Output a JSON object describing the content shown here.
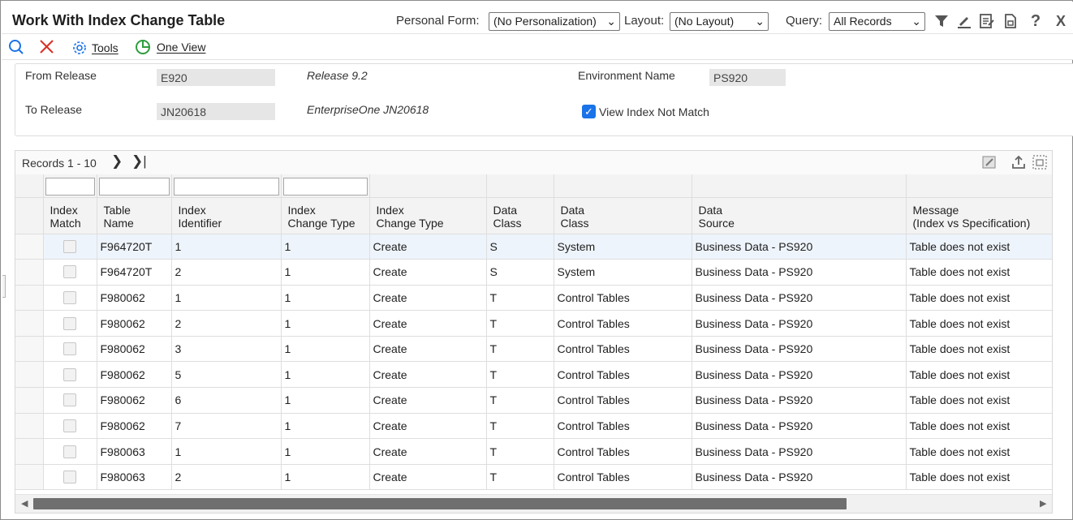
{
  "window": {
    "title": "Work With Index Change Table",
    "personal_form_label": "Personal Form:",
    "personal_form_value": "(No Personalization)",
    "layout_label": "Layout:",
    "layout_value": "(No Layout)",
    "query_label": "Query:",
    "query_value": "All Records",
    "close_glyph": "X",
    "help_glyph": "?"
  },
  "toolbar": {
    "tools_label": "Tools",
    "one_view_label": "One View"
  },
  "header": {
    "from_release_label": "From Release",
    "from_release_value": "E920",
    "from_release_desc": "Release 9.2",
    "to_release_label": "To Release",
    "to_release_value": "JN20618",
    "to_release_desc": "EnterpriseOne JN20618",
    "env_label": "Environment Name",
    "env_value": "PS920",
    "view_index_label": "View Index Not Match",
    "view_index_checked": true
  },
  "grid": {
    "records_label": "Records 1 - 10",
    "columns": [
      {
        "line1": "Index",
        "line2": "Match"
      },
      {
        "line1": "Table",
        "line2": "Name"
      },
      {
        "line1": "Index",
        "line2": "Identifier"
      },
      {
        "line1": "Index",
        "line2": "Change Type"
      },
      {
        "line1": "Index",
        "line2": "Change Type"
      },
      {
        "line1": "Data",
        "line2": "Class"
      },
      {
        "line1": "Data",
        "line2": "Class"
      },
      {
        "line1": "Data",
        "line2": "Source"
      },
      {
        "line1": "Message",
        "line2": "(Index vs Specification)"
      }
    ],
    "rows": [
      {
        "table": "F964720T",
        "id": "1",
        "code": "1",
        "type": "Create",
        "cls": "S",
        "cls_desc": "System",
        "source": "Business Data - PS920",
        "message": "Table does not exist"
      },
      {
        "table": "F964720T",
        "id": "2",
        "code": "1",
        "type": "Create",
        "cls": "S",
        "cls_desc": "System",
        "source": "Business Data - PS920",
        "message": "Table does not exist"
      },
      {
        "table": "F980062",
        "id": "1",
        "code": "1",
        "type": "Create",
        "cls": "T",
        "cls_desc": "Control Tables",
        "source": "Business Data - PS920",
        "message": "Table does not exist"
      },
      {
        "table": "F980062",
        "id": "2",
        "code": "1",
        "type": "Create",
        "cls": "T",
        "cls_desc": "Control Tables",
        "source": "Business Data - PS920",
        "message": "Table does not exist"
      },
      {
        "table": "F980062",
        "id": "3",
        "code": "1",
        "type": "Create",
        "cls": "T",
        "cls_desc": "Control Tables",
        "source": "Business Data - PS920",
        "message": "Table does not exist"
      },
      {
        "table": "F980062",
        "id": "5",
        "code": "1",
        "type": "Create",
        "cls": "T",
        "cls_desc": "Control Tables",
        "source": "Business Data - PS920",
        "message": "Table does not exist"
      },
      {
        "table": "F980062",
        "id": "6",
        "code": "1",
        "type": "Create",
        "cls": "T",
        "cls_desc": "Control Tables",
        "source": "Business Data - PS920",
        "message": "Table does not exist"
      },
      {
        "table": "F980062",
        "id": "7",
        "code": "1",
        "type": "Create",
        "cls": "T",
        "cls_desc": "Control Tables",
        "source": "Business Data - PS920",
        "message": "Table does not exist"
      },
      {
        "table": "F980063",
        "id": "1",
        "code": "1",
        "type": "Create",
        "cls": "T",
        "cls_desc": "Control Tables",
        "source": "Business Data - PS920",
        "message": "Table does not exist"
      },
      {
        "table": "F980063",
        "id": "2",
        "code": "1",
        "type": "Create",
        "cls": "T",
        "cls_desc": "Control Tables",
        "source": "Business Data - PS920",
        "message": "Table does not exist"
      }
    ]
  },
  "colors": {
    "accent": "#1a73e8",
    "search_icon": "#1a73e8",
    "close_red": "#d93025",
    "one_view_green": "#2e9d3f",
    "selected_row": "#eef4fb"
  }
}
